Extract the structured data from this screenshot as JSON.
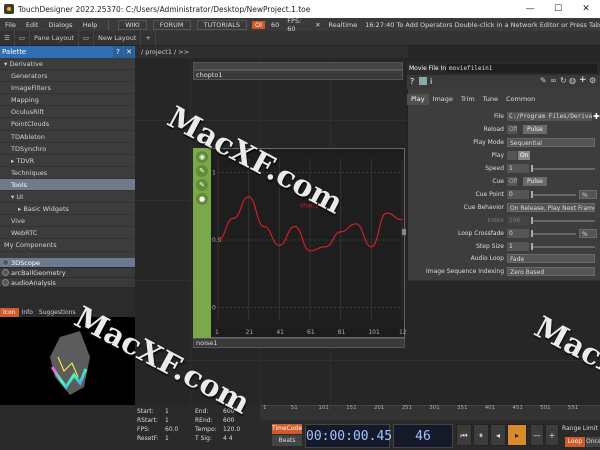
{
  "window": {
    "title": "TouchDesigner 2022.25370: C:/Users/Administrator/Desktop/NewProject.1.toe",
    "min": "—",
    "max": "☐",
    "close": "✕"
  },
  "menubar": {
    "items": [
      "File",
      "Edit",
      "Dialogs",
      "Help"
    ],
    "wiki": "WIKI",
    "forum": "FORUM",
    "tutorials": "TUTORIALS",
    "oi": "OI",
    "sixty": "60",
    "fps": "FPS:  60",
    "realtime": "Realtime",
    "message": "16:27:40 To Add Operators Double-click in a Network Editor or Press Tab"
  },
  "toolbar2": {
    "pane_layout": "Pane Layout",
    "new_layout": "New Layout",
    "plus": "+"
  },
  "palette": {
    "title": "Palette",
    "tree": [
      {
        "label": "▾ Derivative",
        "indent": 0
      },
      {
        "label": "Generators",
        "indent": 1
      },
      {
        "label": "ImageFilters",
        "indent": 1
      },
      {
        "label": "Mapping",
        "indent": 1
      },
      {
        "label": "OculusRift",
        "indent": 1
      },
      {
        "label": "PointClouds",
        "indent": 1
      },
      {
        "label": "TDAbleton",
        "indent": 1
      },
      {
        "label": "TDSynchro",
        "indent": 1
      },
      {
        "label": "▸ TDVR",
        "indent": 1
      },
      {
        "label": "Techniques",
        "indent": 1
      },
      {
        "label": "Tools",
        "indent": 1,
        "selected": true
      },
      {
        "label": "▾ UI",
        "indent": 1
      },
      {
        "label": "▸ Basic Widgets",
        "indent": 2
      },
      {
        "label": "Vive",
        "indent": 1
      },
      {
        "label": "WebRTC",
        "indent": 1
      },
      {
        "label": "My Components",
        "indent": 0
      }
    ],
    "components": [
      {
        "label": "3DScope",
        "selected": true
      },
      {
        "label": "arcBallGeometry",
        "selected": false
      },
      {
        "label": "audioAnalysis",
        "selected": false
      }
    ],
    "preview_tabs": [
      "Icon",
      "Info",
      "Suggestions"
    ]
  },
  "network": {
    "path": "/ project1 / >>",
    "chopto_label": "chopto1",
    "noise_label": "noise1",
    "noise_curve_label": "chan1",
    "y_ticks": [
      "1",
      "0.5",
      "0"
    ],
    "x_ticks": [
      "1",
      "21",
      "41",
      "61",
      "81",
      "101",
      "121"
    ]
  },
  "chart_data": {
    "type": "line",
    "series": [
      {
        "name": "chan1",
        "x": [
          1,
          11,
          21,
          31,
          41,
          51,
          61,
          71,
          81,
          91,
          101,
          111,
          121
        ],
        "values": [
          0.5,
          0.66,
          0.82,
          0.6,
          0.46,
          0.6,
          0.42,
          0.45,
          0.56,
          0.62,
          0.45,
          0.7,
          0.65
        ]
      }
    ],
    "xlim": [
      1,
      121
    ],
    "ylim": [
      -0.1,
      1.1
    ],
    "grid": true
  },
  "param": {
    "type": "Movie File In",
    "name": "moviefilein1",
    "tabs": [
      "Play",
      "Image",
      "Trim",
      "Tune",
      "Common"
    ],
    "rows": [
      {
        "label": "File",
        "value": "C:/Program Files/Derivati",
        "kind": "field"
      },
      {
        "label": "Reload",
        "value": "Off",
        "extra": "Pulse",
        "kind": "toggle"
      },
      {
        "label": "Play Mode",
        "value": "Sequential",
        "kind": "dropdown"
      },
      {
        "label": "Play",
        "value": "On",
        "kind": "toggle-on"
      },
      {
        "label": "Speed",
        "value": "1",
        "kind": "slider"
      },
      {
        "label": "Cue",
        "value": "Off",
        "extra": "Pulse",
        "kind": "toggle"
      },
      {
        "label": "Cue Point",
        "value": "0",
        "unit": "%",
        "kind": "slider-unit"
      },
      {
        "label": "Cue Behavior",
        "value": "On Release, Play Next Frame",
        "kind": "dropdown"
      },
      {
        "label": "Index",
        "value": "196",
        "kind": "dim"
      },
      {
        "label": "Loop Crossfade",
        "value": "0",
        "unit": "%",
        "kind": "slider-unit"
      },
      {
        "label": "Step Size",
        "value": "1",
        "kind": "slider"
      },
      {
        "label": "Audio Loop",
        "value": "Fade",
        "kind": "dropdown"
      },
      {
        "label": "Image Sequence Indexing",
        "value": "Zero Based",
        "kind": "dropdown"
      }
    ]
  },
  "timeline": {
    "ticks": [
      "1",
      "51",
      "101",
      "151",
      "201",
      "251",
      "301",
      "351",
      "401",
      "451",
      "501",
      "551"
    ]
  },
  "time_info": {
    "start_k": "Start:",
    "start_v": "1",
    "end_k": "End:",
    "end_v": "600",
    "rstart_k": "RStart:",
    "rstart_v": "1",
    "rend_k": "REnd:",
    "rend_v": "600",
    "fps_k": "FPS:",
    "fps_v": "60.0",
    "tempo_k": "Tempo:",
    "tempo_v": "120.0",
    "resetf_k": "ResetF:",
    "resetf_v": "1",
    "tsig_k": "T Sig:",
    "tsig_v": "4  4"
  },
  "transport": {
    "timecode_btn": "TimeCode",
    "beats_btn": "Beats",
    "timecode": "00:00:00.45",
    "frame": "46",
    "buttons": [
      "⏮",
      "⏸",
      "◂",
      "▸",
      "—",
      "+"
    ],
    "range": "Range Limit",
    "loop": "Loop",
    "once": "Once"
  },
  "watermark": "MacXF.com"
}
